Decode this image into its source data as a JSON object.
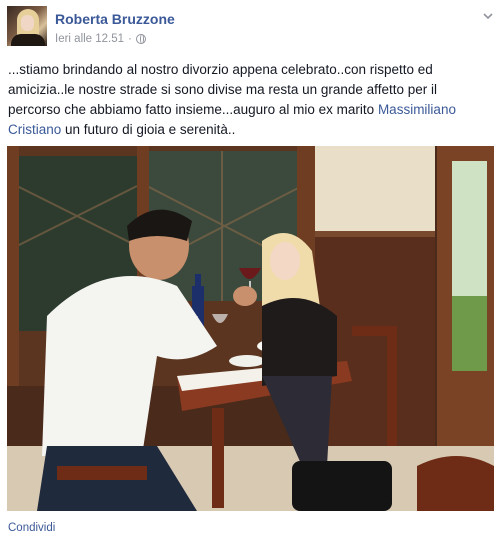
{
  "post": {
    "author": "Roberta Bruzzone",
    "timestamp": "Ieri alle 12.51",
    "separator": "·",
    "privacy_icon": "globe-icon",
    "menu_icon": "chevron-down-icon",
    "text_before_tag": "...stiamo brindando al nostro divorzio appena celebrato..con rispetto ed amicizia..le nostre strade si sono divise ma resta un grande affetto per il percorso che abbiamo fatto insieme...auguro al mio ex marito ",
    "tagged_person": "Massimiliano Cristiano",
    "text_after_tag": " un futuro di gioia e serenità..",
    "photo_description_icon": "photo",
    "share_label": "Condividi"
  },
  "colors": {
    "link": "#3b5998",
    "text": "#141823",
    "meta": "#90949c",
    "background": "#ffffff"
  }
}
